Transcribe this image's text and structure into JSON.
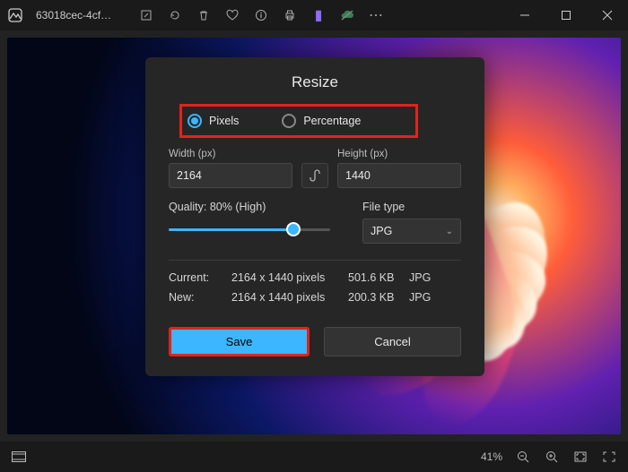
{
  "window": {
    "filename": "63018cec-4cf2-..."
  },
  "dialog": {
    "title": "Resize",
    "unit_pixels": "Pixels",
    "unit_percentage": "Percentage",
    "width_label": "Width  (px)",
    "height_label": "Height  (px)",
    "width_value": "2164",
    "height_value": "1440",
    "quality_label": "Quality: 80% (High)",
    "filetype_label": "File type",
    "filetype_value": "JPG",
    "current_label": "Current:",
    "new_label": "New:",
    "current_dims": "2164 x 1440 pixels",
    "current_size": "501.6 KB",
    "current_fmt": "JPG",
    "new_dims": "2164 x 1440 pixels",
    "new_size": "200.3 KB",
    "new_fmt": "JPG",
    "save_label": "Save",
    "cancel_label": "Cancel"
  },
  "status": {
    "zoom": "41%"
  }
}
